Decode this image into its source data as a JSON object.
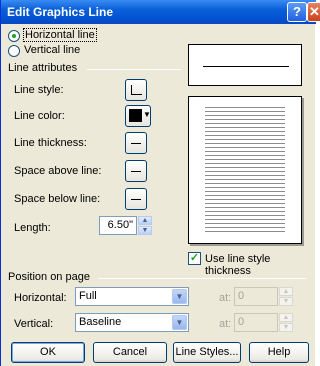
{
  "window": {
    "title": "Edit Graphics Line"
  },
  "titlebar": {
    "help_glyph": "?",
    "close_glyph": "✕"
  },
  "orientation": {
    "horizontal_label": "Horizontal line",
    "vertical_label": "Vertical line",
    "selected": "horizontal"
  },
  "line_attributes": {
    "group_label": "Line attributes",
    "style_label": "Line style:",
    "color_label": "Line color:",
    "thickness_label": "Line thickness:",
    "space_above_label": "Space above line:",
    "space_below_label": "Space below line:",
    "length_label": "Length:",
    "length_value": "6.50\"",
    "color_value": "#000000"
  },
  "use_style_thickness": {
    "label": "Use line style thickness",
    "checked": true
  },
  "position": {
    "group_label": "Position on page",
    "horizontal_label": "Horizontal:",
    "horizontal_value": "Full",
    "vertical_label": "Vertical:",
    "vertical_value": "Baseline",
    "at_label_1": "at:",
    "at_value_1": "0",
    "at_label_2": "at:",
    "at_value_2": "0"
  },
  "buttons": {
    "ok": "OK",
    "cancel": "Cancel",
    "line_styles": "Line Styles...",
    "help": "Help"
  }
}
